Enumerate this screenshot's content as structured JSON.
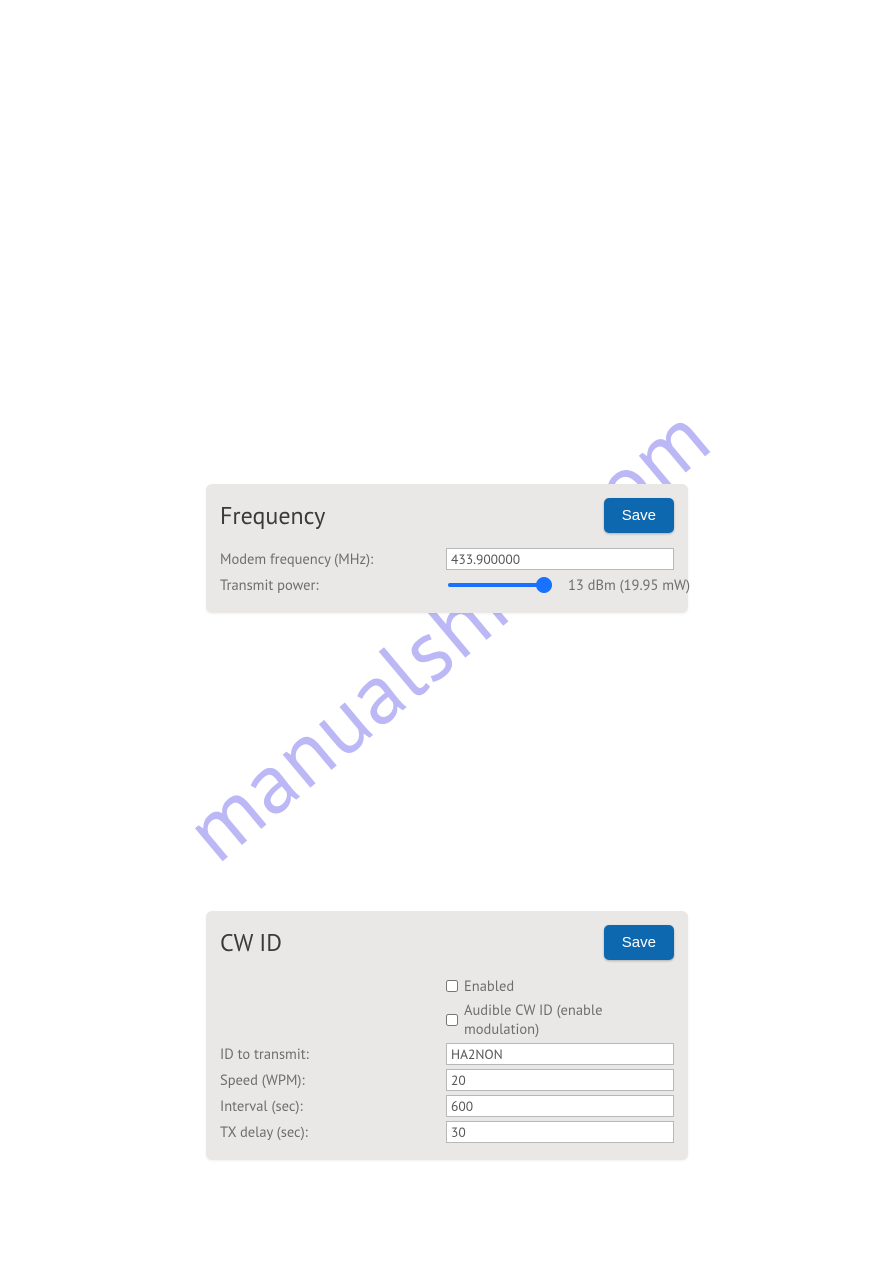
{
  "watermark": "manualshive.com",
  "frequency_panel": {
    "title": "Frequency",
    "save": "Save",
    "modem_label": "Modem frequency (MHz):",
    "modem_value": "433.900000",
    "txpower_label": "Transmit power:",
    "txpower_slider": 100,
    "txpower_readout": "13 dBm (19.95 mW)"
  },
  "cw_panel": {
    "title": "CW ID",
    "save": "Save",
    "enabled_label": "Enabled",
    "enabled_checked": false,
    "audible_label": "Audible CW ID (enable modulation)",
    "audible_checked": false,
    "id_label": "ID to transmit:",
    "id_value": "HA2NON",
    "speed_label": "Speed (WPM):",
    "speed_value": "20",
    "interval_label": "Interval (sec):",
    "interval_value": "600",
    "txdelay_label": "TX delay (sec):",
    "txdelay_value": "30"
  }
}
